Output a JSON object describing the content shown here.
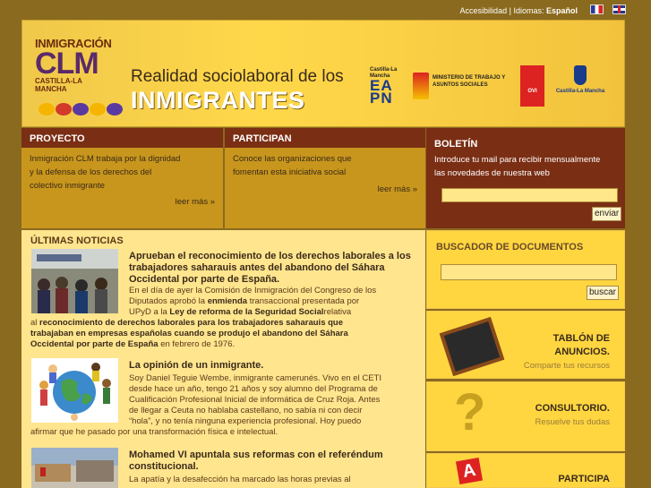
{
  "topbar": {
    "accesibilidad": "Accesibilidad",
    "separator": "|",
    "idiomas_label": "Idiomas:",
    "current_language": "Español",
    "flags": [
      "flag-france-icon",
      "flag-uk-icon"
    ]
  },
  "header": {
    "logo_top": "INMIGRACIÓN",
    "logo_main": "CLM",
    "logo_bottom": "CASTILLA-LA MANCHA",
    "title_small": "Realidad sociolaboral de los",
    "title_big": "INMIGRANTES",
    "eapn_region": "Castilla-La Mancha",
    "eapn_letters": "EAPN",
    "ministry": "MINISTERIO DE TRABAJO Y ASUNTOS SOCIALES",
    "ovi": "OVI",
    "clm_gov": "Castilla-La Mancha",
    "dot_colors": [
      "#f5b400",
      "#d23a2a",
      "#5a3aa0",
      "#f5b400",
      "#5a3aa0"
    ]
  },
  "proyecto": {
    "title": "PROYECTO",
    "lines": [
      "Inmigración CLM trabaja por la dignidad",
      "y la defensa de los derechos del",
      "colectivo inmigrante"
    ],
    "more": "leer más »"
  },
  "participan": {
    "title": "PARTICIPAN",
    "lines": [
      "Conoce las organizaciones que",
      "fomentan esta iniciativa social"
    ],
    "more": "leer más »"
  },
  "boletin": {
    "title": "BOLETÍN",
    "lines": [
      "Introduce tu mail para recibir mensualmente",
      "las novedades de nuestra web"
    ],
    "email_value": "",
    "submit": "enviar"
  },
  "news": {
    "title": "ÚLTIMAS NOTICIAS",
    "items": [
      {
        "headline": "Aprueban el reconocimiento de los derechos laborales a los trabajadores saharauis antes del abandono del Sáhara Occidental por parte de España.",
        "p1": "En el día de ayer la Comisión de Inmigración del Congreso de los",
        "p2": "Diputados aprobó la",
        "p2b": "enmienda",
        "p2c": "transaccional presentada por",
        "p3": "UPyD a la",
        "p3b": "Ley de reforma de la Seguridad Social",
        "p3c": "relativa",
        "p4a": "al",
        "p4b": "reconocimiento de derechos laborales para los trabajadores saharauis que",
        "p5": "trabajaban en empresas españolas cuando se produjo el abandono del Sáhara",
        "p6b": "Occidental por parte de España",
        "p6c": "en febrero de 1976."
      },
      {
        "headline": "La opinión de un inmigrante.",
        "p1": "Soy Daniel Teguie Wembe, inmigrante camerunés. Vivo en el CETI",
        "p2": "desde hace un año, tengo 21 años y soy alumno del Programa de",
        "p3": "Cualificación Profesional Inicial de informática de Cruz Roja. Antes",
        "p4": "de llegar a Ceuta no hablaba castellano, no sabía ni con decir",
        "p5": "“hola”, y no tenía ninguna experiencia profesional. Hoy puedo",
        "p6": "afirmar que he pasado por una transformación física e intelectual."
      },
      {
        "headline": "Mohamed VI apuntala sus reformas con el referéndum constitucional.",
        "p1": "La apatía y la desafección ha marcado las horas previas al"
      }
    ]
  },
  "buscador": {
    "title": "BUSCADOR DE DOCUMENTOS",
    "query": "",
    "submit": "buscar"
  },
  "cards": {
    "tablon_title1": "TABLÓN DE",
    "tablon_title2": "ANUNCIOS.",
    "tablon_sub": "Comparte tus recursos",
    "consultorio_title": "CONSULTORIO.",
    "consultorio_sub": "Resuelve tus dudas",
    "participa_title": "PARTICIPA",
    "icons": [
      "chalkboard-icon",
      "question-mark-icon",
      "letter-block-icon"
    ]
  }
}
